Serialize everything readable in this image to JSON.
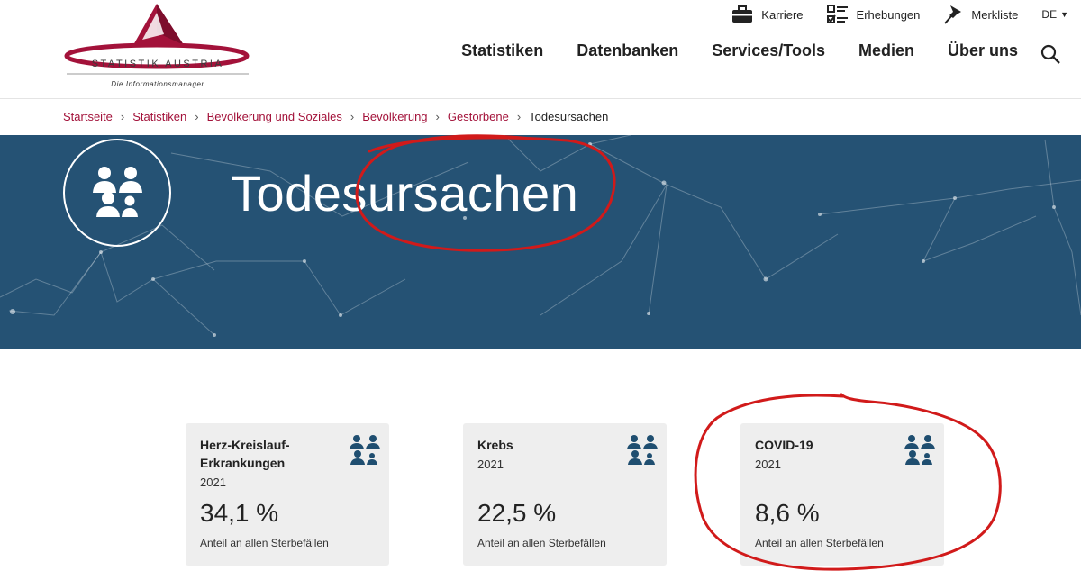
{
  "logo": {
    "name": "STATISTIK AUSTRIA",
    "tagline": "Die Informationsmanager"
  },
  "utility_nav": [
    {
      "label": "Karriere",
      "icon": "briefcase-icon"
    },
    {
      "label": "Erhebungen",
      "icon": "survey-checklist-icon"
    },
    {
      "label": "Merkliste",
      "icon": "pushpin-icon"
    }
  ],
  "language": {
    "label": "DE",
    "icon": "chevron-down-icon"
  },
  "main_nav": [
    "Statistiken",
    "Datenbanken",
    "Services/Tools",
    "Medien",
    "Über uns"
  ],
  "search": {
    "icon": "search-icon"
  },
  "breadcrumb": [
    "Startseite",
    "Statistiken",
    "Bevölkerung und Soziales",
    "Bevölkerung",
    "Gestorbene"
  ],
  "breadcrumb_current": "Todesursachen",
  "breadcrumb_separator": "›",
  "hero": {
    "title": "Todesursachen",
    "icon": "population-group-icon",
    "background": "#255274"
  },
  "cards": [
    {
      "title": "Herz-Kreislauf-Erkrankungen",
      "year": "2021",
      "value": "34,1 %",
      "caption": "Anteil an allen Sterbefällen",
      "icon": "population-group-icon"
    },
    {
      "title": "Krebs",
      "year": "2021",
      "value": "22,5 %",
      "caption": "Anteil an allen Sterbefällen",
      "icon": "population-group-icon"
    },
    {
      "title": "COVID-19",
      "year": "2021",
      "value": "8,6 %",
      "caption": "Anteil an allen Sterbefällen",
      "icon": "population-group-icon"
    }
  ],
  "colors": {
    "brand_red": "#a3123a",
    "hero_blue": "#255274",
    "card_bg": "#eeeeee",
    "icon_blue": "#1f4e70",
    "annotation_red": "#d11a1a"
  }
}
